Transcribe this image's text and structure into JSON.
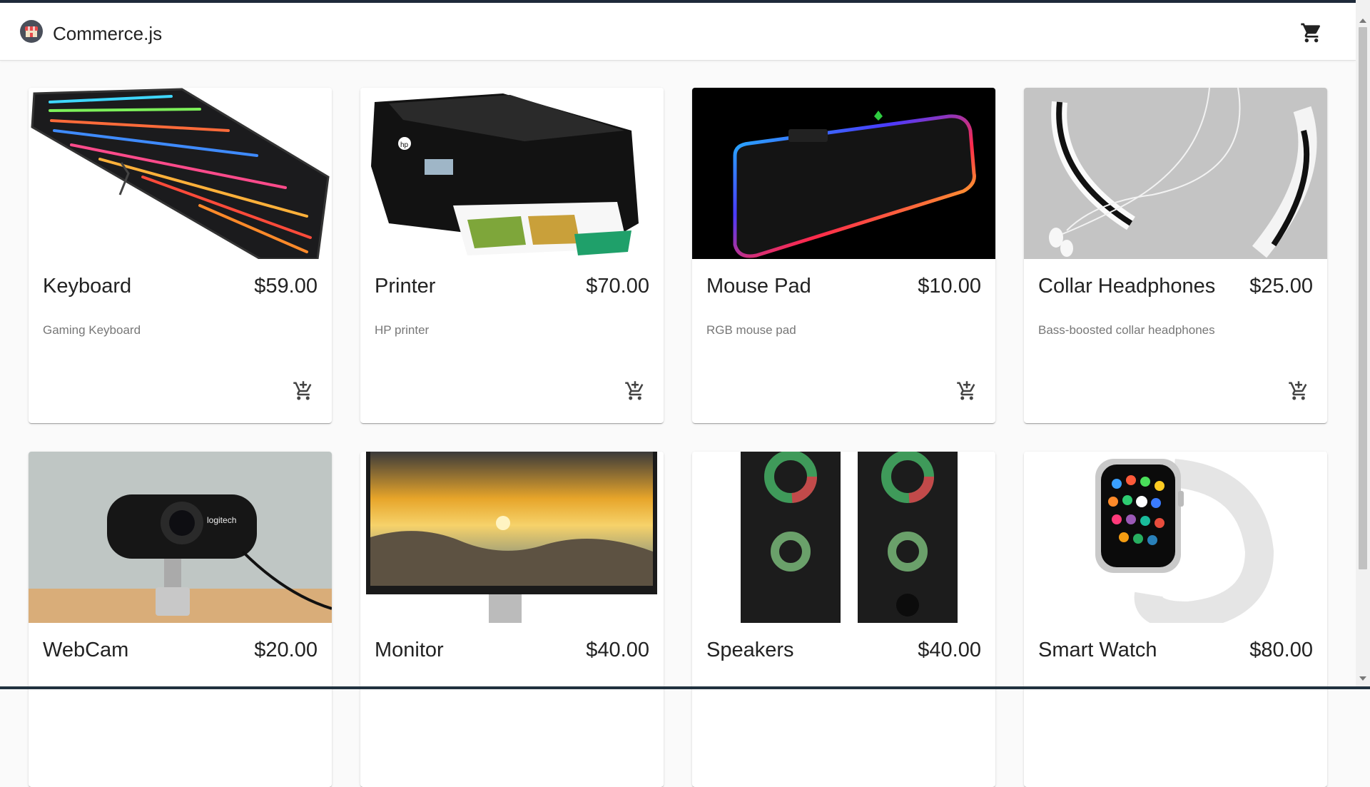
{
  "app": {
    "brand": "Commerce.js"
  },
  "icons": {
    "logo": "shop-logo-icon",
    "cart": "shopping-cart-icon",
    "add_to_cart": "add-shopping-cart-icon"
  },
  "products": [
    {
      "name": "Keyboard",
      "price": "$59.00",
      "description": "Gaming Keyboard",
      "image": "keyboard-image"
    },
    {
      "name": "Printer",
      "price": "$70.00",
      "description": "HP printer",
      "image": "printer-image"
    },
    {
      "name": "Mouse Pad",
      "price": "$10.00",
      "description": "RGB mouse pad",
      "image": "mousepad-image"
    },
    {
      "name": "Collar Headphones",
      "price": "$25.00",
      "description": "Bass-boosted collar headphones",
      "image": "headphones-image"
    },
    {
      "name": "WebCam",
      "price": "$20.00",
      "image": "webcam-image"
    },
    {
      "name": "Monitor",
      "price": "$40.00",
      "image": "monitor-image"
    },
    {
      "name": "Speakers",
      "price": "$40.00",
      "image": "speakers-image"
    },
    {
      "name": "Smart Watch",
      "price": "$80.00",
      "image": "smartwatch-image"
    }
  ]
}
